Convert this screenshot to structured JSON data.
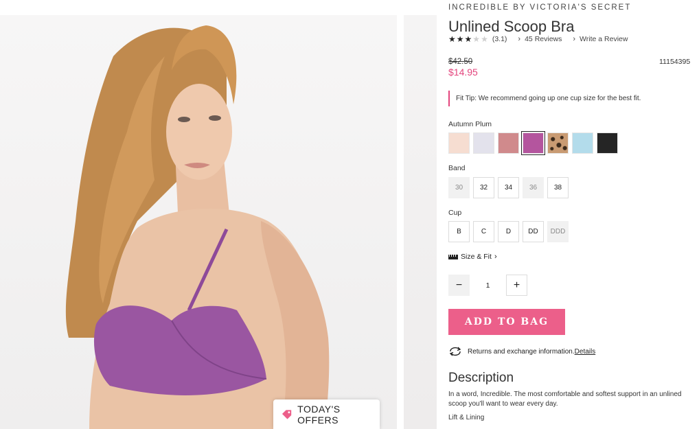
{
  "gallery": {
    "offers_label": "TODAY'S OFFERS"
  },
  "product": {
    "brand": "INCREDIBLE BY VICTORIA'S SECRET",
    "title": "Unlined Scoop Bra",
    "rating_value": "(3.1)",
    "stars_filled": 3,
    "stars_total": 5,
    "reviews_label": "45 Reviews",
    "write_review_label": "Write a Review",
    "price_old": "$42.50",
    "price_new": "$14.95",
    "sku": "11154395",
    "fit_tip": "Fit Tip: We recommend going up one cup size for the best fit.",
    "color_selected": "Autumn Plum",
    "swatches": [
      {
        "color": "#f6ddd1",
        "selected": false
      },
      {
        "color": "#e3e2ec",
        "selected": false
      },
      {
        "color": "#d08a8c",
        "selected": false
      },
      {
        "color": "#b4559e",
        "selected": true
      },
      {
        "color": "leopard",
        "selected": false
      },
      {
        "color": "#b3dceb",
        "selected": false
      },
      {
        "color": "#252525",
        "selected": false
      }
    ],
    "band_label": "Band",
    "bands": [
      {
        "label": "30",
        "available": false
      },
      {
        "label": "32",
        "available": true
      },
      {
        "label": "34",
        "available": true
      },
      {
        "label": "36",
        "available": false
      },
      {
        "label": "38",
        "available": true
      }
    ],
    "cup_label": "Cup",
    "cups": [
      {
        "label": "B",
        "available": true
      },
      {
        "label": "C",
        "available": true
      },
      {
        "label": "D",
        "available": true
      },
      {
        "label": "DD",
        "available": true
      },
      {
        "label": "DDD",
        "available": false
      }
    ],
    "size_fit_label": "Size & Fit",
    "quantity": "1",
    "add_to_bag_label": "ADD TO BAG",
    "returns_text": "Returns and exchange information.",
    "returns_link": "Details",
    "description_title": "Description",
    "description_body": "In a word, Incredible. The most comfortable and softest support in an unlined scoop you'll want to wear every day.",
    "description_sub": "Lift & Lining"
  },
  "colors": {
    "accent_pink": "#e3457d",
    "button_pink": "#ec5f8a"
  }
}
